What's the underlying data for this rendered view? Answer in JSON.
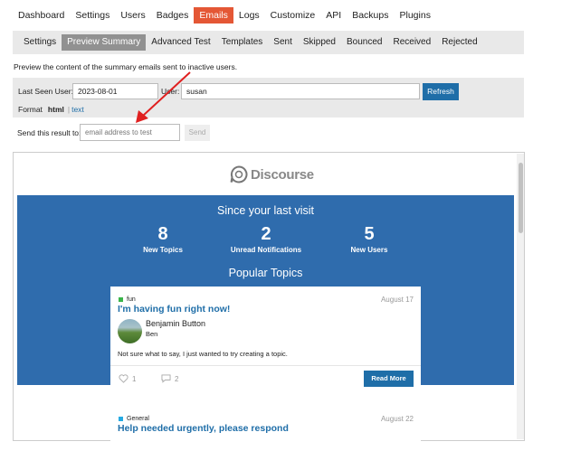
{
  "top_nav": {
    "items": [
      "Dashboard",
      "Settings",
      "Users",
      "Badges",
      "Emails",
      "Logs",
      "Customize",
      "API",
      "Backups",
      "Plugins"
    ],
    "active": "Emails"
  },
  "sub_nav": {
    "items": [
      "Settings",
      "Preview Summary",
      "Advanced Test",
      "Templates",
      "Sent",
      "Skipped",
      "Bounced",
      "Received",
      "Rejected"
    ],
    "active": "Preview Summary"
  },
  "description": "Preview the content of the summary emails sent to inactive users.",
  "filters": {
    "last_seen_label": "Last Seen User:",
    "last_seen_value": "2023-08-01",
    "user_label": "User:",
    "user_value": "susan",
    "refresh_label": "Refresh",
    "format_label": "Format",
    "format_html": "html",
    "format_sep": "|",
    "format_text": "text"
  },
  "send": {
    "label": "Send this result to:",
    "placeholder": "email address to test",
    "button": "Send"
  },
  "email_preview": {
    "logo_text": "Discourse",
    "hero_title": "Since your last visit",
    "stats": [
      {
        "value": "8",
        "label": "New Topics"
      },
      {
        "value": "2",
        "label": "Unread Notifications"
      },
      {
        "value": "5",
        "label": "New Users"
      }
    ],
    "popular_title": "Popular Topics",
    "topics": [
      {
        "category": "fun",
        "category_color": "#3ab54a",
        "date": "August 17",
        "title": "I'm having fun right now!",
        "author_name": "Benjamin Button",
        "author_username": "Ben",
        "excerpt": "Not sure what to say, I just wanted to try creating a topic.",
        "likes": "1",
        "replies": "2",
        "read_more": "Read More"
      },
      {
        "category": "General",
        "category_color": "#25aae2",
        "date": "August 22",
        "title": "Help needed urgently, please respond"
      }
    ]
  },
  "colors": {
    "accent": "#e45735",
    "primary_blue": "#1f6ea8",
    "hero_blue": "#2f6cad",
    "annotation_arrow": "#e02020"
  }
}
